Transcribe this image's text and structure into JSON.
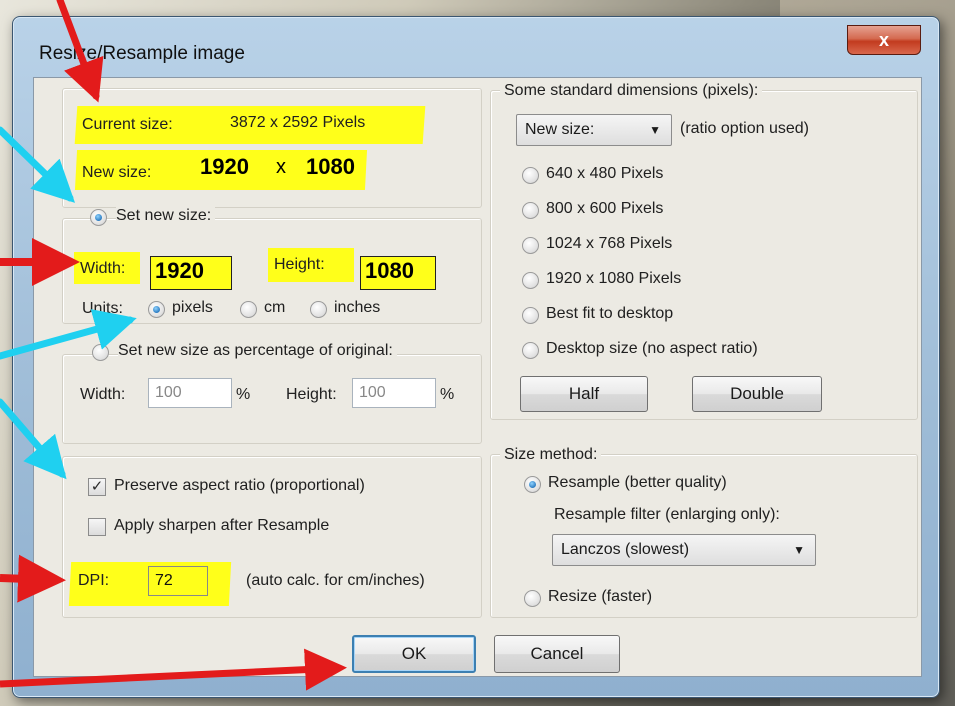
{
  "dialog": {
    "title": "Resize/Resample image",
    "close_label": "x"
  },
  "size_info": {
    "current_label": "Current size:",
    "current_value": "3872  x  2592  Pixels",
    "new_label": "New size:",
    "new_width": "1920",
    "new_x": "x",
    "new_height": "1080"
  },
  "set_new_size": {
    "label": "Set new size:",
    "selected": true,
    "width_label": "Width:",
    "width_value": "1920",
    "height_label": "Height:",
    "height_value": "1080",
    "units_label": "Units:",
    "units": [
      {
        "label": "pixels",
        "selected": true
      },
      {
        "label": "cm",
        "selected": false
      },
      {
        "label": "inches",
        "selected": false
      }
    ]
  },
  "percentage": {
    "label": "Set new size as percentage of original:",
    "width_label": "Width:",
    "width_value": "100",
    "pct1": "%",
    "height_label": "Height:",
    "height_value": "100",
    "pct2": "%"
  },
  "options": {
    "preserve_aspect": "Preserve aspect ratio (proportional)",
    "preserve_checked": true,
    "apply_sharpen": "Apply sharpen after Resample",
    "sharpen_checked": false,
    "dpi_label": "DPI:",
    "dpi_value": "72",
    "dpi_note": "(auto calc. for cm/inches)"
  },
  "standard": {
    "title": "Some standard dimensions (pixels):",
    "combo_value": "New size:",
    "combo_note": "(ratio option used)",
    "items": [
      "640 x 480 Pixels",
      "800 x 600 Pixels",
      "1024 x 768 Pixels",
      "1920 x 1080 Pixels",
      "Best fit to desktop",
      "Desktop size (no aspect ratio)"
    ],
    "half_label": "Half",
    "double_label": "Double"
  },
  "method": {
    "title": "Size method:",
    "resample_label": "Resample (better quality)",
    "filter_label": "Resample filter (enlarging only):",
    "filter_value": "Lanczos (slowest)",
    "resize_label": "Resize (faster)"
  },
  "buttons": {
    "ok": "OK",
    "cancel": "Cancel"
  },
  "annotation_colors": {
    "red_arrow": "#e31b1b",
    "cyan_arrow": "#1fd0f0",
    "highlight": "#ffff1a"
  }
}
